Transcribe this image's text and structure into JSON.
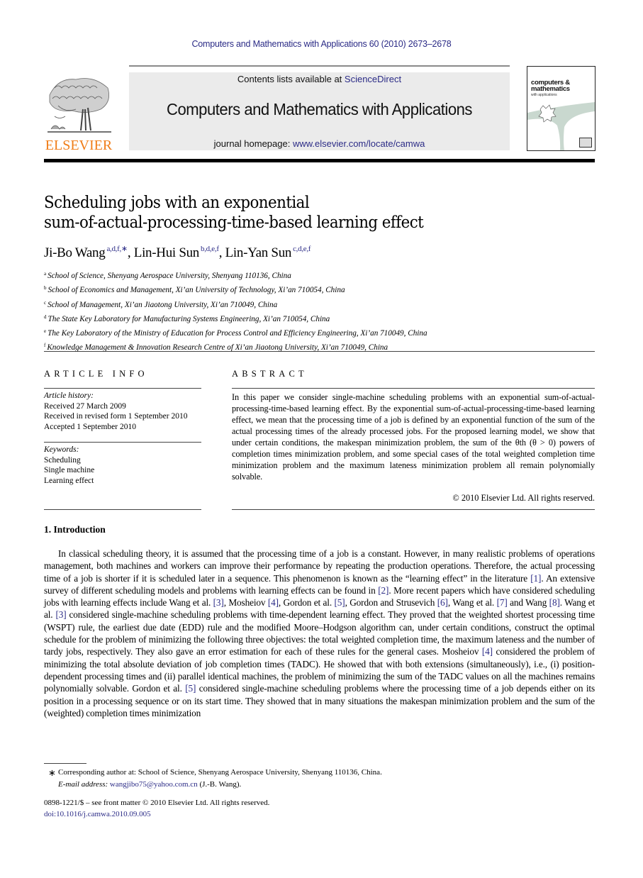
{
  "running_head": "Computers and Mathematics with Applications 60 (2010) 2673–2678",
  "header": {
    "publisher_wordmark": "ELSEVIER",
    "contents_prefix": "Contents lists available at ",
    "contents_link": "ScienceDirect",
    "journal_title": "Computers and Mathematics with Applications",
    "homepage_prefix": "journal homepage: ",
    "homepage_link": "www.elsevier.com/locate/camwa",
    "cover": {
      "line1": "computers &",
      "line2": "mathematics",
      "line3": "with applications"
    },
    "colors": {
      "link": "#2b2b86",
      "elsevier_orange": "#f07d18",
      "band": "#ebebeb"
    }
  },
  "article": {
    "title_line1": "Scheduling jobs with an exponential",
    "title_line2": "sum-of-actual-processing-time-based learning effect",
    "authors": [
      {
        "name": "Ji-Bo Wang",
        "sup": "a,d,f,∗",
        "sep": ", "
      },
      {
        "name": "Lin-Hui Sun",
        "sup": "b,d,e,f",
        "sep": ", "
      },
      {
        "name": "Lin-Yan Sun",
        "sup": "c,d,e,f",
        "sep": ""
      }
    ],
    "affiliations": [
      {
        "key": "a",
        "text": "School of Science, Shenyang Aerospace University, Shenyang 110136, China"
      },
      {
        "key": "b",
        "text": "School of Economics and Management, Xi’an University of Technology, Xi’an 710054, China"
      },
      {
        "key": "c",
        "text": "School of Management, Xi’an Jiaotong University, Xi’an 710049, China"
      },
      {
        "key": "d",
        "text": "The State Key Laboratory for Manufacturing Systems Engineering, Xi’an 710054, China"
      },
      {
        "key": "e",
        "text": "The Key Laboratory of the Ministry of Education for Process Control and Efficiency Engineering, Xi’an 710049, China"
      },
      {
        "key": "f",
        "text": "Knowledge Management & Innovation Research Centre of Xi’an Jiaotong University, Xi’an 710049, China"
      }
    ]
  },
  "article_info": {
    "heading": "ARTICLE INFO",
    "history_label": "Article history:",
    "history": [
      "Received 27 March 2009",
      "Received in revised form 1 September 2010",
      "Accepted 1 September 2010"
    ],
    "keywords_label": "Keywords:",
    "keywords": [
      "Scheduling",
      "Single machine",
      "Learning effect"
    ]
  },
  "abstract": {
    "heading": "ABSTRACT",
    "text": "In this paper we consider single-machine scheduling problems with an exponential sum-of-actual-processing-time-based learning effect. By the exponential sum-of-actual-processing-time-based learning effect, we mean that the processing time of a job is defined by an exponential function of the sum of the actual processing times of the already processed jobs. For the proposed learning model, we show that under certain conditions, the makespan minimization problem, the sum of the θth (θ > 0) powers of completion times minimization problem, and some special cases of the total weighted completion time minimization problem and the maximum lateness minimization problem all remain polynomially solvable.",
    "copyright": "© 2010 Elsevier Ltd. All rights reserved."
  },
  "introduction": {
    "heading": "1.  Introduction",
    "segments": [
      {
        "t": "In classical scheduling theory, it is assumed that the processing time of a job is a constant. However, in many realistic problems of operations management, both machines and workers can improve their performance by repeating the production operations. Therefore, the actual processing time of a job is shorter if it is scheduled later in a sequence. This phenomenon is known as the “learning effect” in the literature "
      },
      {
        "ref": "[1]"
      },
      {
        "t": ". An extensive survey of different scheduling models and problems with learning effects can be found in "
      },
      {
        "ref": "[2]"
      },
      {
        "t": ". More recent papers which have considered scheduling jobs with learning effects include Wang et al. "
      },
      {
        "ref": "[3]"
      },
      {
        "t": ", Mosheiov "
      },
      {
        "ref": "[4]"
      },
      {
        "t": ", Gordon et al. "
      },
      {
        "ref": "[5]"
      },
      {
        "t": ", Gordon and Strusevich "
      },
      {
        "ref": "[6]"
      },
      {
        "t": ", Wang et al. "
      },
      {
        "ref": "[7]"
      },
      {
        "t": " and Wang "
      },
      {
        "ref": "[8]"
      },
      {
        "t": ". Wang et al. "
      },
      {
        "ref": "[3]"
      },
      {
        "t": " considered single-machine scheduling problems with time-dependent learning effect. They proved that the weighted shortest processing time (WSPT) rule, the earliest due date (EDD) rule and the modified Moore–Hodgson algorithm can, under certain conditions, construct the optimal schedule for the problem of minimizing the following three objectives: the total weighted completion time, the maximum lateness and the number of tardy jobs, respectively. They also gave an error estimation for each of these rules for the general cases. Mosheiov "
      },
      {
        "ref": "[4]"
      },
      {
        "t": " considered the problem of minimizing the total absolute deviation of job completion times (TADC). He showed that with both extensions (simultaneously), i.e., (i) position-dependent processing times and (ii) parallel identical machines, the problem of minimizing the sum of the TADC values on all the machines remains polynomially solvable. Gordon et al. "
      },
      {
        "ref": "[5]"
      },
      {
        "t": " considered single-machine scheduling problems where the processing time of a job depends either on its position in a processing sequence or on its start time. They showed that in many situations the makespan  minimization problem and the sum of the (weighted) completion times minimization"
      }
    ]
  },
  "footnotes": {
    "star": "∗",
    "corresponding": "Corresponding author at: School of Science, Shenyang Aerospace University, Shenyang 110136, China.",
    "email_label": "E-mail address: ",
    "email": "wangjibo75@yahoo.com.cn",
    "email_suffix": " (J.-B. Wang).",
    "issn_line": "0898-1221/$ – see front matter © 2010 Elsevier Ltd. All rights reserved.",
    "doi": "doi:10.1016/j.camwa.2010.09.005"
  }
}
